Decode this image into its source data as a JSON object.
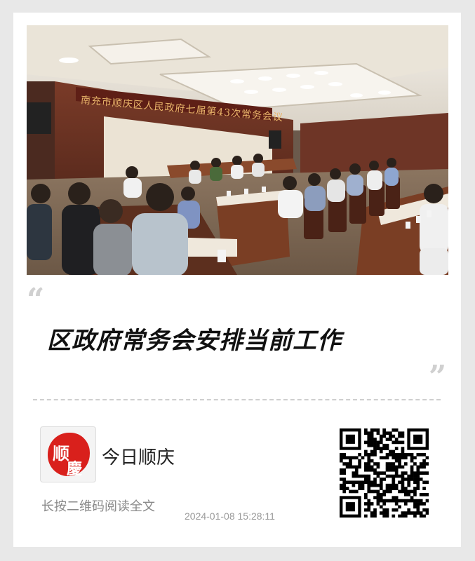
{
  "photo": {
    "banner_text": "南充市顺庆区人民政府七届第43次常务会议"
  },
  "quote": {
    "open_mark": "“",
    "close_mark": "”"
  },
  "headline": "区政府常务会安排当前工作",
  "account": {
    "name": "今日顺庆",
    "logo_chars": [
      "顺",
      "慶"
    ]
  },
  "hint": "长按二维码阅读全文",
  "timestamp": "2024-01-08 15:28:11",
  "colors": {
    "background": "#e8e8e8",
    "card": "#ffffff",
    "logo_red": "#d9201c",
    "headline": "#111111"
  }
}
